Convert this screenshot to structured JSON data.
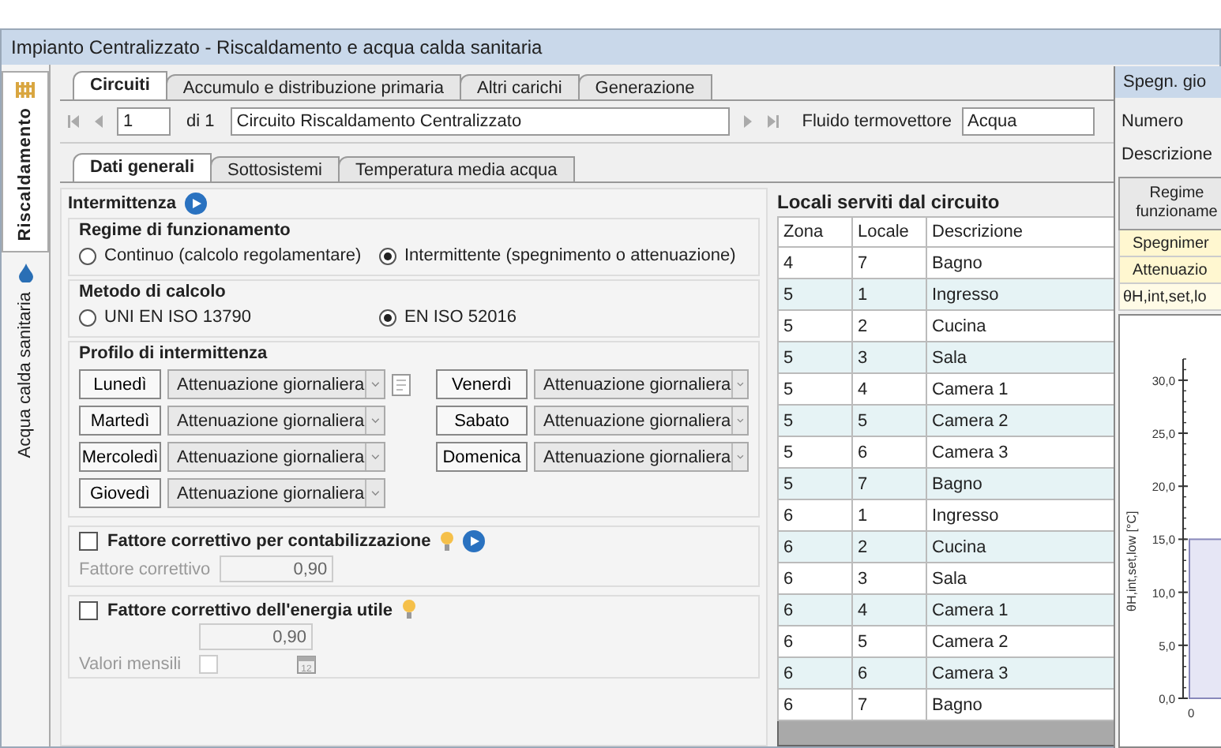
{
  "window": {
    "title": "Impianto Centralizzato - Riscaldamento e acqua calda sanitaria"
  },
  "side_tabs": [
    {
      "label": "Riscaldamento",
      "selected": true,
      "kind": "heating"
    },
    {
      "label": "Acqua calda sanitaria",
      "selected": false,
      "kind": "water"
    }
  ],
  "tabs": [
    {
      "label": "Circuiti",
      "selected": true
    },
    {
      "label": "Accumulo e distribuzione primaria",
      "selected": false
    },
    {
      "label": "Altri carichi",
      "selected": false
    },
    {
      "label": "Generazione",
      "selected": false
    }
  ],
  "navigator": {
    "record": "1",
    "count": "di 1",
    "name": "Circuito Riscaldamento Centralizzato",
    "fluid_label": "Fluido termovettore",
    "fluid": "Acqua"
  },
  "subtabs": [
    {
      "label": "Dati generali",
      "selected": true
    },
    {
      "label": "Sottosistemi",
      "selected": false
    },
    {
      "label": "Temperatura media acqua",
      "selected": false
    }
  ],
  "intermittenza": {
    "title": "Intermittenza",
    "regime": {
      "title": "Regime di funzionamento",
      "options": [
        {
          "label": "Continuo (calcolo regolamentare)",
          "selected": false
        },
        {
          "label": "Intermittente (spegnimento o attenuazione)",
          "selected": true
        }
      ]
    },
    "metodo": {
      "title": "Metodo di calcolo",
      "options": [
        {
          "label": "UNI EN ISO 13790",
          "selected": false
        },
        {
          "label": "EN ISO 52016",
          "selected": true
        }
      ]
    },
    "profilo": {
      "title": "Profilo di intermittenza",
      "days": [
        {
          "day": "Lunedì",
          "value": "Attenuazione giornaliera"
        },
        {
          "day": "Martedì",
          "value": "Attenuazione giornaliera"
        },
        {
          "day": "Mercoledì",
          "value": "Attenuazione giornaliera"
        },
        {
          "day": "Giovedì",
          "value": "Attenuazione giornaliera"
        },
        {
          "day": "Venerdì",
          "value": "Attenuazione giornaliera"
        },
        {
          "day": "Sabato",
          "value": "Attenuazione giornaliera"
        },
        {
          "day": "Domenica",
          "value": "Attenuazione giornaliera"
        }
      ]
    }
  },
  "contabilizzazione": {
    "label": "Fattore correttivo per contabilizzazione",
    "checked": false,
    "field_label": "Fattore correttivo",
    "value": "0,90"
  },
  "energia": {
    "label": "Fattore correttivo dell'energia utile",
    "checked": false,
    "value": "0,90",
    "monthly_label": "Valori mensili",
    "monthly_checked": false,
    "calendar_day": "12"
  },
  "locali": {
    "title": "Locali serviti dal circuito",
    "columns": [
      "Zona",
      "Locale",
      "Descrizione"
    ],
    "rows": [
      [
        "4",
        "7",
        "Bagno"
      ],
      [
        "5",
        "1",
        "Ingresso"
      ],
      [
        "5",
        "2",
        "Cucina"
      ],
      [
        "5",
        "3",
        "Sala"
      ],
      [
        "5",
        "4",
        " Camera 1"
      ],
      [
        "5",
        "5",
        "Camera 2"
      ],
      [
        "5",
        "6",
        "Camera 3"
      ],
      [
        "5",
        "7",
        "Bagno"
      ],
      [
        "6",
        "1",
        "Ingresso"
      ],
      [
        "6",
        "2",
        "Cucina"
      ],
      [
        "6",
        "3",
        "Sala"
      ],
      [
        "6",
        "4",
        "Camera 1"
      ],
      [
        "6",
        "5",
        "Camera 2"
      ],
      [
        "6",
        "6",
        "Camera 3"
      ],
      [
        "6",
        "7",
        "Bagno"
      ]
    ]
  },
  "side_window": {
    "title": "Spegn. gio",
    "numero_label": "Numero",
    "descrizione_label": "Descrizione",
    "header": "Regime\nfunzioname",
    "rows": [
      "Spegnimer",
      "Attenuazio",
      "θH,int,set,lo"
    ],
    "chart_data": {
      "type": "bar",
      "ylabel": "θH,int,set,low [°C]",
      "x": [
        "0"
      ],
      "values": [
        15.0
      ],
      "ylim": [
        0,
        32
      ],
      "yticks": [
        {
          "value": 0,
          "label": "0,0"
        },
        {
          "value": 5,
          "label": "5,0"
        },
        {
          "value": 10,
          "label": "10,0"
        },
        {
          "value": 15,
          "label": "15,0"
        },
        {
          "value": 20,
          "label": "20,0"
        },
        {
          "value": 25,
          "label": "25,0"
        },
        {
          "value": 30,
          "label": "30,0"
        }
      ]
    }
  }
}
